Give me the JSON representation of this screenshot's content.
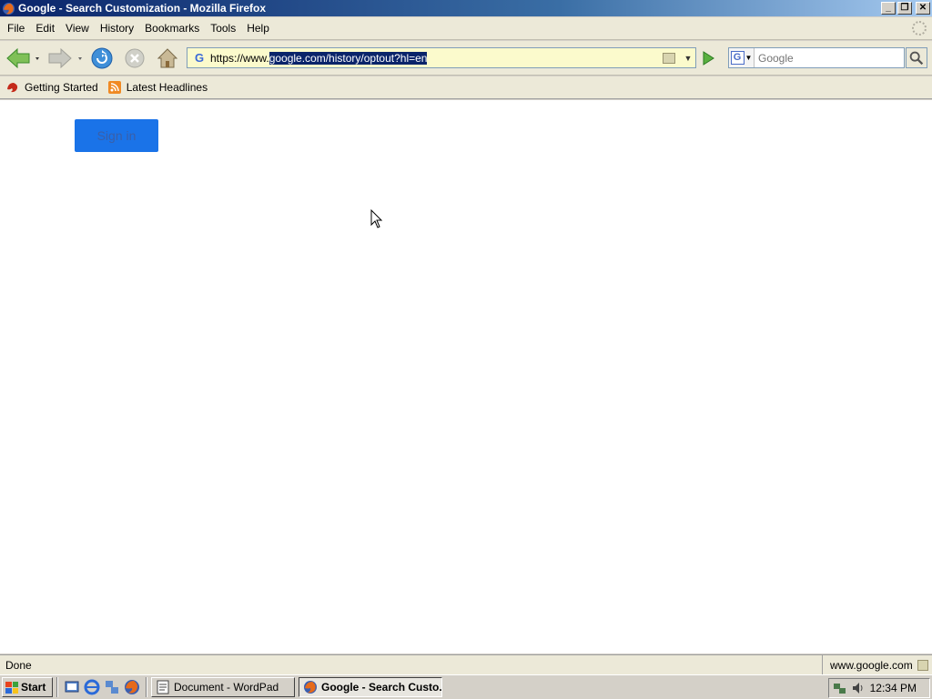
{
  "window": {
    "title": "Google - Search Customization - Mozilla Firefox"
  },
  "menu": [
    "File",
    "Edit",
    "View",
    "History",
    "Bookmarks",
    "Tools",
    "Help"
  ],
  "urlbar": {
    "prefix": "https://www.",
    "selected": "google.com/history/optout?hl=en"
  },
  "search": {
    "placeholder": "Google",
    "engine": "G"
  },
  "bookmarks": [
    "Getting Started",
    "Latest Headlines"
  ],
  "content": {
    "button_label": "Sign in"
  },
  "status": {
    "text": "Done",
    "host": "www.google.com"
  },
  "taskbar": {
    "start": "Start",
    "tasks": [
      "Document - WordPad",
      "Google - Search Custo..."
    ],
    "clock": "12:34 PM"
  },
  "colors": {
    "accent": "#1a73e8",
    "titlebar": "#0a246a"
  }
}
